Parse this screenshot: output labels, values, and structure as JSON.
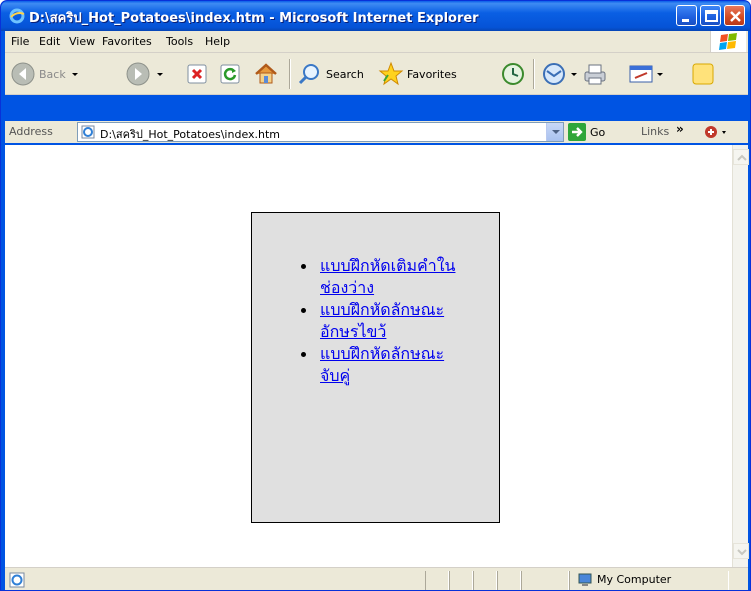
{
  "window": {
    "title": "D:\\สคริป_Hot_Potatoes\\index.htm - Microsoft Internet Explorer"
  },
  "menu": {
    "items": [
      {
        "label": "File",
        "accesskey_char": "F"
      },
      {
        "label": "Edit",
        "accesskey_char": "E"
      },
      {
        "label": "View",
        "accesskey_char": "V"
      },
      {
        "label": "Favorites",
        "accesskey_char": "a"
      },
      {
        "label": "Tools",
        "accesskey_char": "T"
      },
      {
        "label": "Help",
        "accesskey_char": "H"
      }
    ]
  },
  "toolbar": {
    "back_label": "Back",
    "search_label": "Search",
    "favorites_label": "Favorites"
  },
  "address": {
    "label": "Address",
    "value": "D:\\สคริป_Hot_Potatoes\\index.htm",
    "go_label": "Go",
    "links_label": "Links",
    "chevron": "»"
  },
  "content": {
    "links": [
      "แบบฝึกหัดเติมคำในช่องว่าง",
      "แบบฝึกหัดลักษณะอักษรไขว้",
      "แบบฝึกหัดลักษณะจับคู่"
    ]
  },
  "status": {
    "zone": "My Computer"
  },
  "colors": {
    "titlebar": "#0054e3",
    "chrome": "#ece9d8",
    "link": "#0000ee",
    "panel": "#e0e0e0"
  },
  "icons": [
    "ie-icon",
    "minimize-icon",
    "maximize-icon",
    "close-icon",
    "windows-logo-icon",
    "back-icon",
    "forward-icon",
    "stop-icon",
    "refresh-icon",
    "home-icon",
    "search-icon",
    "favorites-star-icon",
    "history-icon",
    "mail-icon",
    "print-icon",
    "edit-icon",
    "messenger-icon",
    "go-arrow-icon",
    "page-icon",
    "computer-icon"
  ]
}
